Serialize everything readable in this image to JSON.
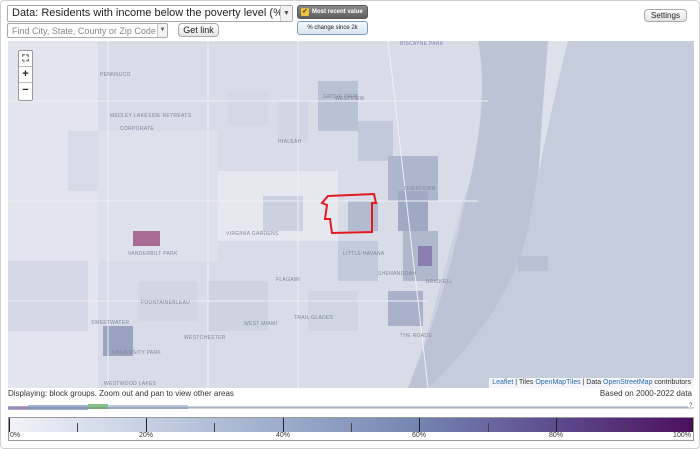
{
  "controls": {
    "data_select": "Data: Residents with income below the poverty level (%)",
    "search_placeholder": "Find City, State, County or Zip Code",
    "get_link": "Get link",
    "settings": "Settings",
    "mode_recent": "Most recent value",
    "mode_change": "% change since 2k"
  },
  "map": {
    "zoom_in": "+",
    "zoom_out": "−",
    "fullscreen": "⛶",
    "attribution": {
      "leaflet": "Leaflet",
      "tiles_prefix": " | Tiles ",
      "tiles": "OpenMapTiles",
      "data_prefix": " | Data ",
      "data": "OpenStreetMap",
      "data_suffix": " contributors"
    },
    "labels": [
      "PENNSUCO",
      "MEDLEY LAKESIDE RETREATS",
      "CORPORATE",
      "VIRGINIA GARDENS",
      "SWEETWATER",
      "UNIVERSITY PARK",
      "WESTCHESTER",
      "FOUNTAINEBLEAU",
      "VANDERBILT PARK",
      "LITTLE HAVANA",
      "FLAGAMI",
      "WESTWOOD LAKES",
      "GROVE PARK",
      "BISCAYNE PARK",
      "HIALEAH",
      "WESTVIEW",
      "BRICKELL",
      "THE ROADS",
      "TRAIL GLADES",
      "WEST MIAMI",
      "SHENANDOAH",
      "OVERTOWN"
    ]
  },
  "footer": {
    "display_text": "Displaying: block groups. Zoom out and pan to view other areas",
    "based_text": "Based on 2000-2022 data"
  },
  "legend": {
    "labels": [
      "0%",
      "20%",
      "40%",
      "60%",
      "80%",
      "100%"
    ],
    "gradient_colors": [
      "#f1f3f8",
      "#c6d0e3",
      "#9cacca",
      "#7484b2",
      "#5d4b8e",
      "#4c0f5e"
    ],
    "highlight_color": "#e3191c"
  }
}
